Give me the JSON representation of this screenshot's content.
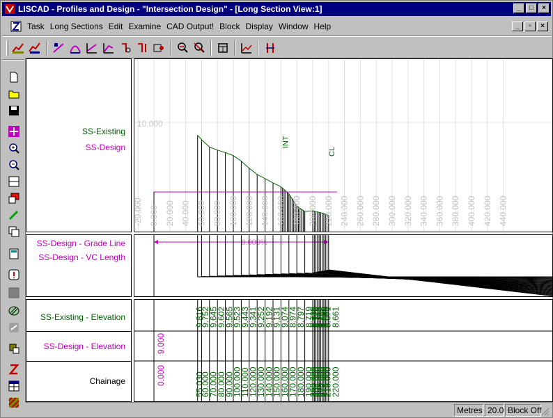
{
  "window": {
    "title": "LISCAD - Profiles and Design - \"Intersection Design\" - [Long Section View:1]",
    "caption_buttons": [
      "_",
      "□",
      "×"
    ],
    "mdi_buttons": [
      "_",
      "▫",
      "×"
    ]
  },
  "menu": [
    "Task",
    "Long Sections",
    "Edit",
    "Examine",
    "CAD Output!",
    "Block",
    "Display",
    "Window",
    "Help"
  ],
  "toolbar_icons": [
    "profile-open-icon",
    "profile-edit-icon",
    "design-grade-icon",
    "design-vc-icon",
    "design-edit-icon",
    "design-line-icon",
    "insert-point-icon",
    "delete-point-icon",
    "move-point-icon",
    "zoom-window-icon",
    "zoom-extents-icon",
    "section-icon",
    "graph-icon",
    "reverse-icon"
  ],
  "left_tools": [
    "new-icon",
    "open-icon",
    "save-icon",
    "pan-icon",
    "zoom-in-icon",
    "zoom-out-icon",
    "fit-icon",
    "layer-icon",
    "pencil-icon",
    "copy-icon",
    "calculator-icon",
    "warning-icon",
    "box-icon",
    "hatch-icon",
    "link-icon",
    "plot-icon",
    "intersect-icon",
    "table-icon",
    "texture-icon"
  ],
  "profile": {
    "labels": {
      "existing": "SS-Existing",
      "design": "SS-Design"
    },
    "datum_label": "10.000",
    "markers": {
      "int": "INT",
      "cl": "CL"
    },
    "chainage_ticks": [
      "-20.000",
      "0.000",
      "20.000",
      "40.000",
      "60.000",
      "80.000",
      "100.000",
      "120.000",
      "140.000",
      "160.000",
      "180.000",
      "200.000",
      "220.000",
      "240.000",
      "260.000",
      "280.000",
      "300.000",
      "320.000",
      "340.000",
      "360.000",
      "380.000",
      "400.000",
      "420.000",
      "440.000"
    ],
    "design_color": "#c000c0",
    "existing_color": "#006400"
  },
  "grade": {
    "label_grade_line": "SS-Design - Grade Line",
    "label_vc_length": "SS-Design - VC Length",
    "grade_value": "0.000%"
  },
  "table": {
    "label_existing": "SS-Existing - Elevation",
    "label_design": "SS-Design - Elevation",
    "label_chainage": "Chainage",
    "design_start": {
      "chainage": "0.000",
      "elevation": "9.000"
    },
    "columns": [
      {
        "chainage": "55.030",
        "existing": "9.816"
      },
      {
        "chainage": "60.000",
        "existing": "9.752"
      },
      {
        "chainage": "70.000",
        "existing": "9.645"
      },
      {
        "chainage": "80.000",
        "existing": "9.602"
      },
      {
        "chainage": "90.000",
        "existing": "9.565"
      },
      {
        "chainage": "100.000",
        "existing": "9.523"
      },
      {
        "chainage": "110.000",
        "existing": "9.443"
      },
      {
        "chainage": "120.000",
        "existing": "9.341"
      },
      {
        "chainage": "130.000",
        "existing": "9.252"
      },
      {
        "chainage": "140.000",
        "existing": "9.192"
      },
      {
        "chainage": "150.000",
        "existing": "9.131"
      },
      {
        "chainage": "160.000",
        "existing": "9.074"
      },
      {
        "chainage": "170.000",
        "existing": "8.974"
      },
      {
        "chainage": "180.000",
        "existing": "8.797"
      },
      {
        "chainage": "190.000",
        "existing": "8.719"
      },
      {
        "chainage": "200.000",
        "existing": "8.730"
      },
      {
        "chainage": "202.000",
        "existing": "8.725"
      },
      {
        "chainage": "204.000",
        "existing": "8.719"
      },
      {
        "chainage": "206.000",
        "existing": "8.713"
      },
      {
        "chainage": "208.000",
        "existing": "8.707"
      },
      {
        "chainage": "210.000",
        "existing": "8.702"
      },
      {
        "chainage": "212.000",
        "existing": "8.696"
      },
      {
        "chainage": "214.000",
        "existing": "8.689"
      },
      {
        "chainage": "216.000",
        "existing": "8.680"
      },
      {
        "chainage": "218.000",
        "existing": "8.671"
      },
      {
        "chainage": "220.000",
        "existing": "8.661"
      }
    ]
  },
  "status": {
    "units": "Metres",
    "scale": "20.0",
    "block": "Block Off"
  }
}
